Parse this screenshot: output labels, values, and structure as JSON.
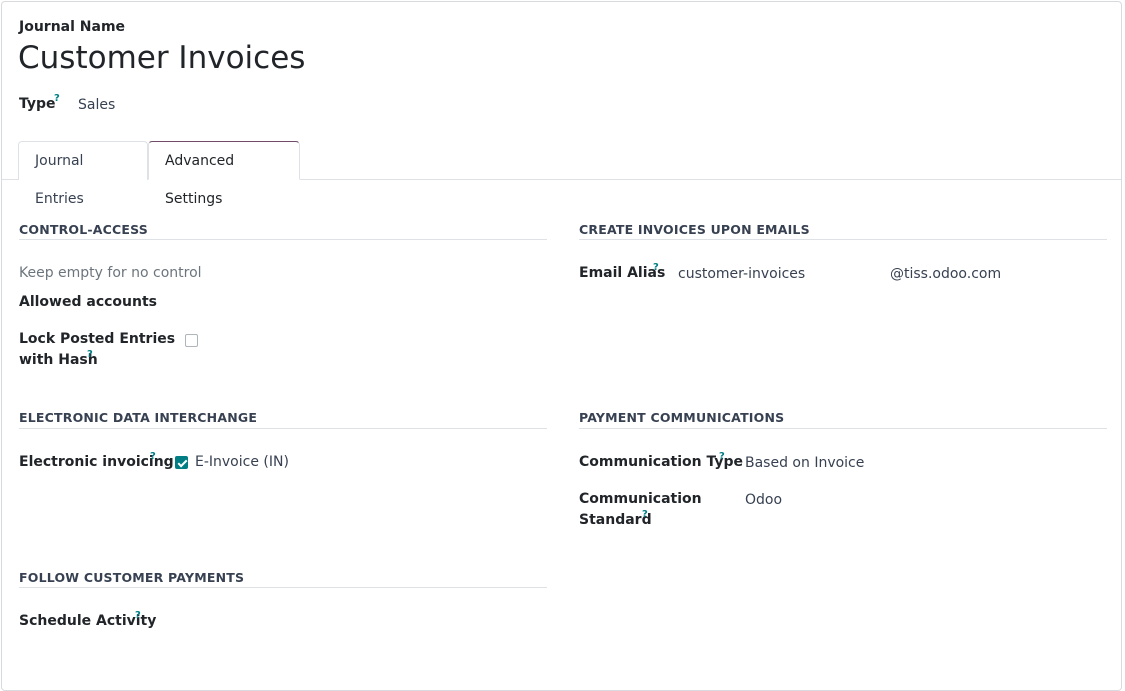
{
  "header": {
    "journal_name_label": "Journal Name",
    "journal_name_value": "Customer Invoices",
    "type_label": "Type",
    "type_value": "Sales",
    "help_mark": "?"
  },
  "tabs": [
    {
      "label": "Journal Entries",
      "active": false
    },
    {
      "label": "Advanced Settings",
      "active": true
    }
  ],
  "control_access": {
    "title": "CONTROL-ACCESS",
    "allowed_accounts_placeholder": "Keep empty for no control",
    "allowed_accounts_label": "Allowed accounts",
    "lock_label_line1": "Lock Posted Entries",
    "lock_label_line2": "with Hash",
    "lock_checked": false
  },
  "create_invoices": {
    "title": "CREATE INVOICES UPON EMAILS",
    "email_alias_label": "Email Alias",
    "email_alias_value": "customer-invoices",
    "email_domain": "@tiss.odoo.com"
  },
  "edi": {
    "title": "ELECTRONIC DATA INTERCHANGE",
    "electronic_invoicing_label": "Electronic invoicing",
    "einvoice_option": "E-Invoice (IN)",
    "einvoice_checked": true
  },
  "payment_communications": {
    "title": "PAYMENT COMMUNICATIONS",
    "communication_type_label": "Communication Type",
    "communication_type_value": "Based on Invoice",
    "communication_standard_line1": "Communication",
    "communication_standard_line2": "Standard",
    "communication_standard_value": "Odoo"
  },
  "follow_payments": {
    "title": "FOLLOW CUSTOMER PAYMENTS",
    "schedule_activity_label": "Schedule Activity"
  },
  "colors": {
    "accent": "#017e84",
    "tab_active_border": "#714b67"
  }
}
